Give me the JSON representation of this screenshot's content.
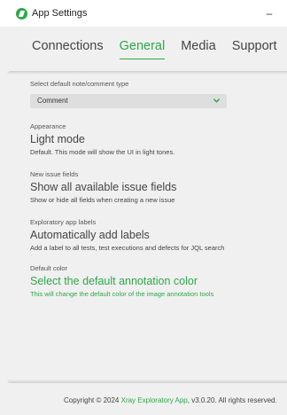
{
  "window": {
    "title": "App Settings",
    "minimize_glyph": "–"
  },
  "tabs": [
    {
      "label": "Connections",
      "active": false
    },
    {
      "label": "General",
      "active": true
    },
    {
      "label": "Media",
      "active": false
    },
    {
      "label": "Support",
      "active": false
    }
  ],
  "general": {
    "note_type": {
      "label": "Select default note/comment type",
      "selected": "Comment"
    },
    "appearance": {
      "label": "Appearance",
      "value": "Light mode",
      "description": "Default. This mode will show the UI in light tones."
    },
    "issue_fields": {
      "label": "New issue fields",
      "value": "Show all available issue fields",
      "description": "Show or hide all fields when creating a new issue"
    },
    "labels": {
      "label": "Exploratory app labels",
      "value": "Automatically add labels",
      "description": "Add a label to all tests, test executions and defects for JQL search"
    },
    "color": {
      "label": "Default color",
      "value": "Select the default annotation color",
      "description": "This will change the default color of the image annotation tools"
    }
  },
  "footer": {
    "prefix": "Copyright © 2024 ",
    "link": "Xray Exploratory App",
    "suffix": ", v3.0.20. All rights reserved."
  },
  "colors": {
    "accent": "#2ea84a",
    "background": "#f0f0f0",
    "select_bg": "#dedede"
  },
  "icons": {
    "app": "app-logo-icon",
    "dropdown": "chevron-down-icon"
  }
}
